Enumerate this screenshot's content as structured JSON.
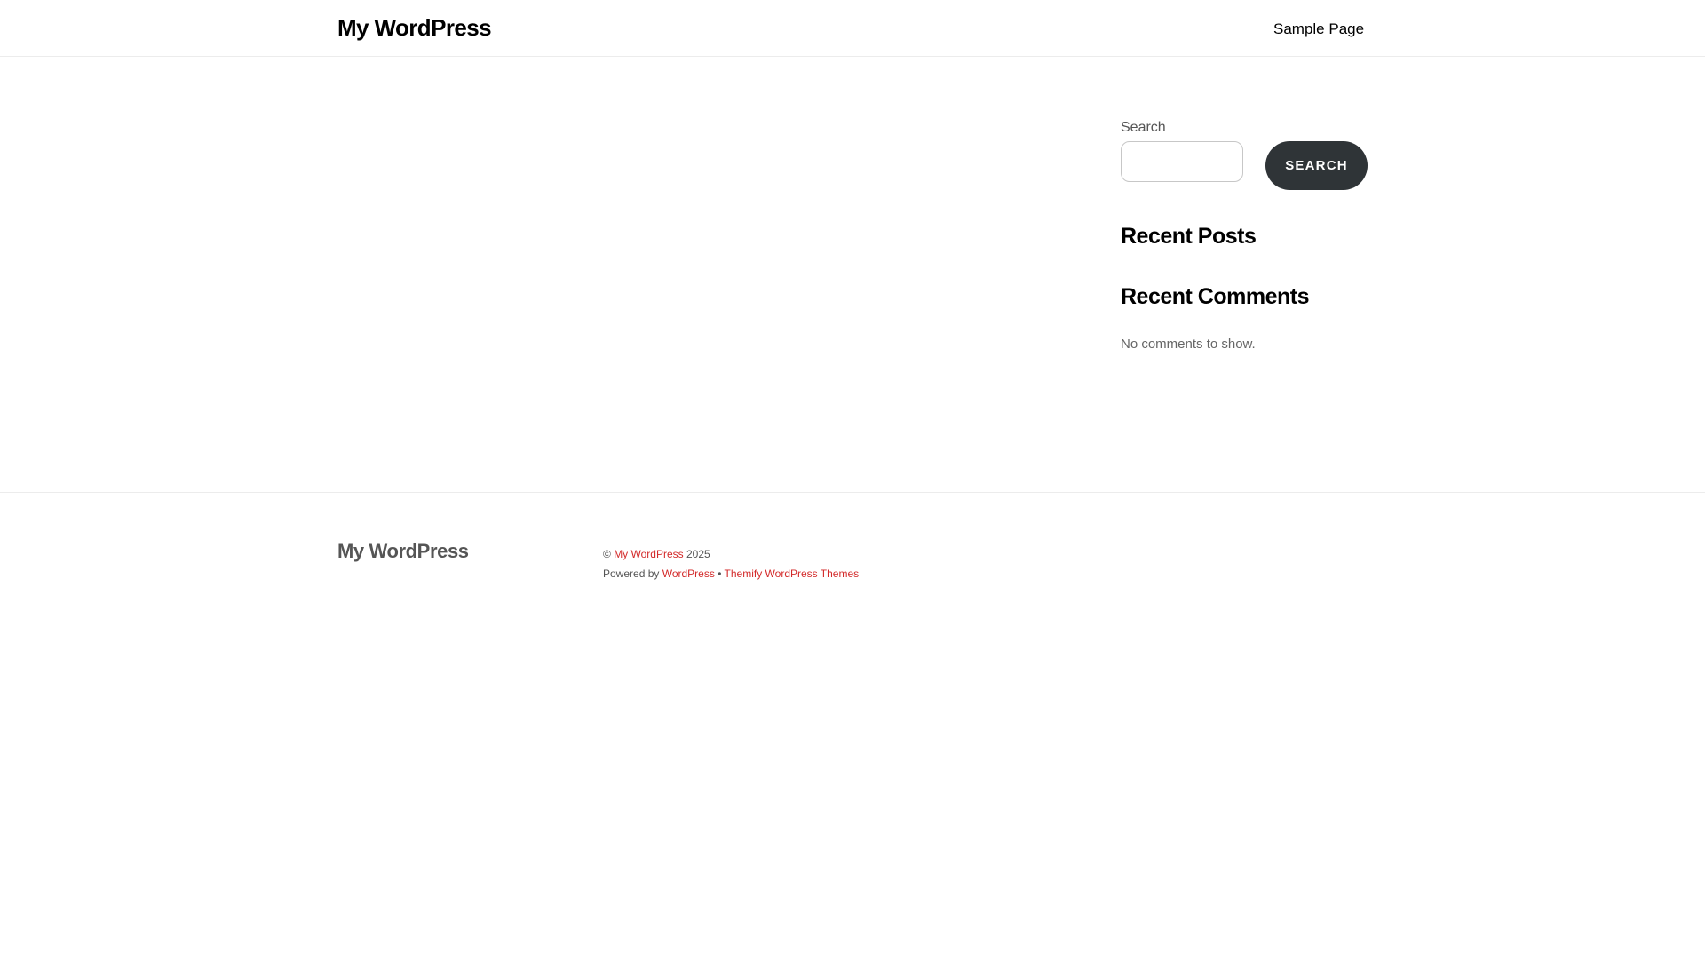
{
  "header": {
    "site_title": "My WordPress",
    "nav": [
      {
        "label": "Sample Page"
      }
    ]
  },
  "sidebar": {
    "search": {
      "label": "Search",
      "value": "",
      "placeholder": "",
      "button_label": "SEARCH"
    },
    "recent_posts": {
      "title": "Recent Posts"
    },
    "recent_comments": {
      "title": "Recent Comments",
      "empty_text": "No comments to show."
    }
  },
  "footer": {
    "site_title": "My WordPress",
    "copyright_symbol": "©",
    "copyright_link": "My WordPress",
    "year": "2025",
    "powered_by_prefix": "Powered by",
    "powered_by_link": "WordPress",
    "separator": "•",
    "theme_link": "Themify WordPress Themes"
  },
  "colors": {
    "link": "#d32a2a",
    "button_bg": "#2f3437",
    "text_muted": "#555555"
  }
}
